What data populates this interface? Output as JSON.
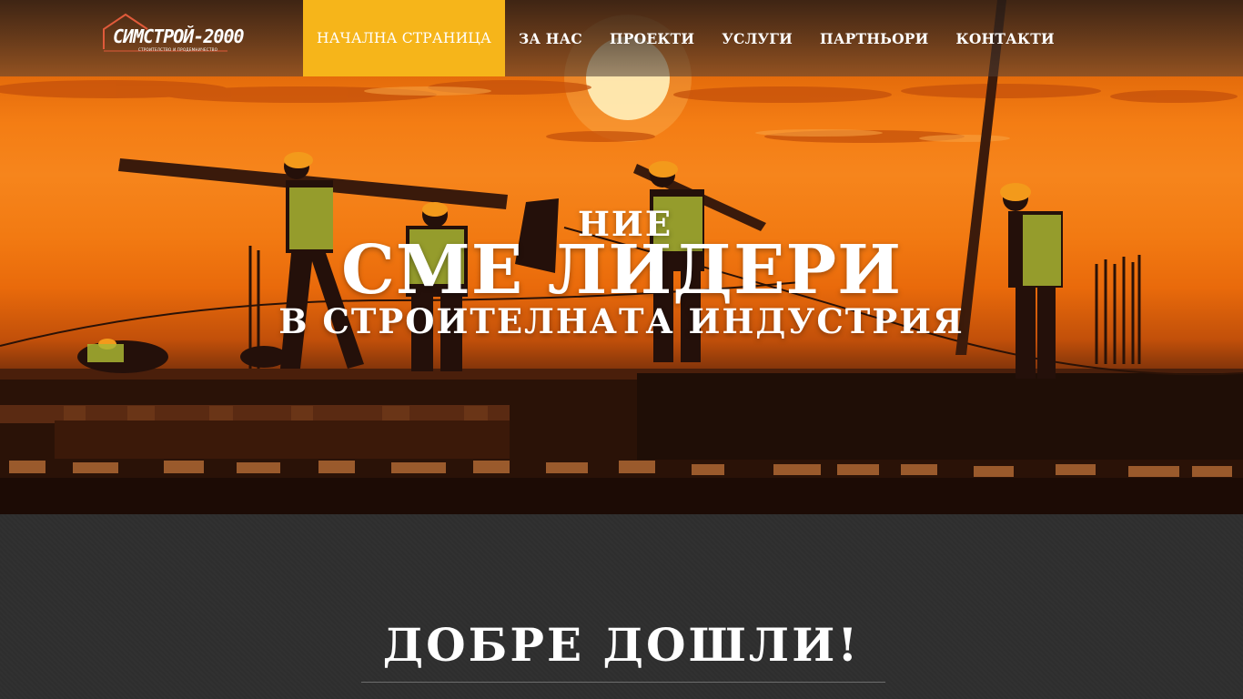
{
  "brand": {
    "name": "СИМСТРОЙ-2000",
    "tagline": "СТРОИТЕЛСТВО И ПРОДЕМНИЧЕСТВО"
  },
  "nav": {
    "items": [
      {
        "label": "НАЧАЛНА СТРАНИЦА",
        "active": true
      },
      {
        "label": "ЗА НАС",
        "active": false
      },
      {
        "label": "ПРОЕКТИ",
        "active": false
      },
      {
        "label": "УСЛУГИ",
        "active": false
      },
      {
        "label": "ПАРТНЬОРИ",
        "active": false
      },
      {
        "label": "КОНТАКТИ",
        "active": false
      }
    ]
  },
  "hero": {
    "line1": "НИЕ",
    "line2": "СМЕ ЛИДЕРИ",
    "line3": "В СТРОИТЕЛНАТА ИНДУСТРИЯ"
  },
  "welcome": {
    "title": "ДОБРЕ ДОШЛИ!"
  },
  "colors": {
    "active_nav": "#f6b51a",
    "sky": "#f47d14",
    "dark_section": "#2f2f2f"
  }
}
